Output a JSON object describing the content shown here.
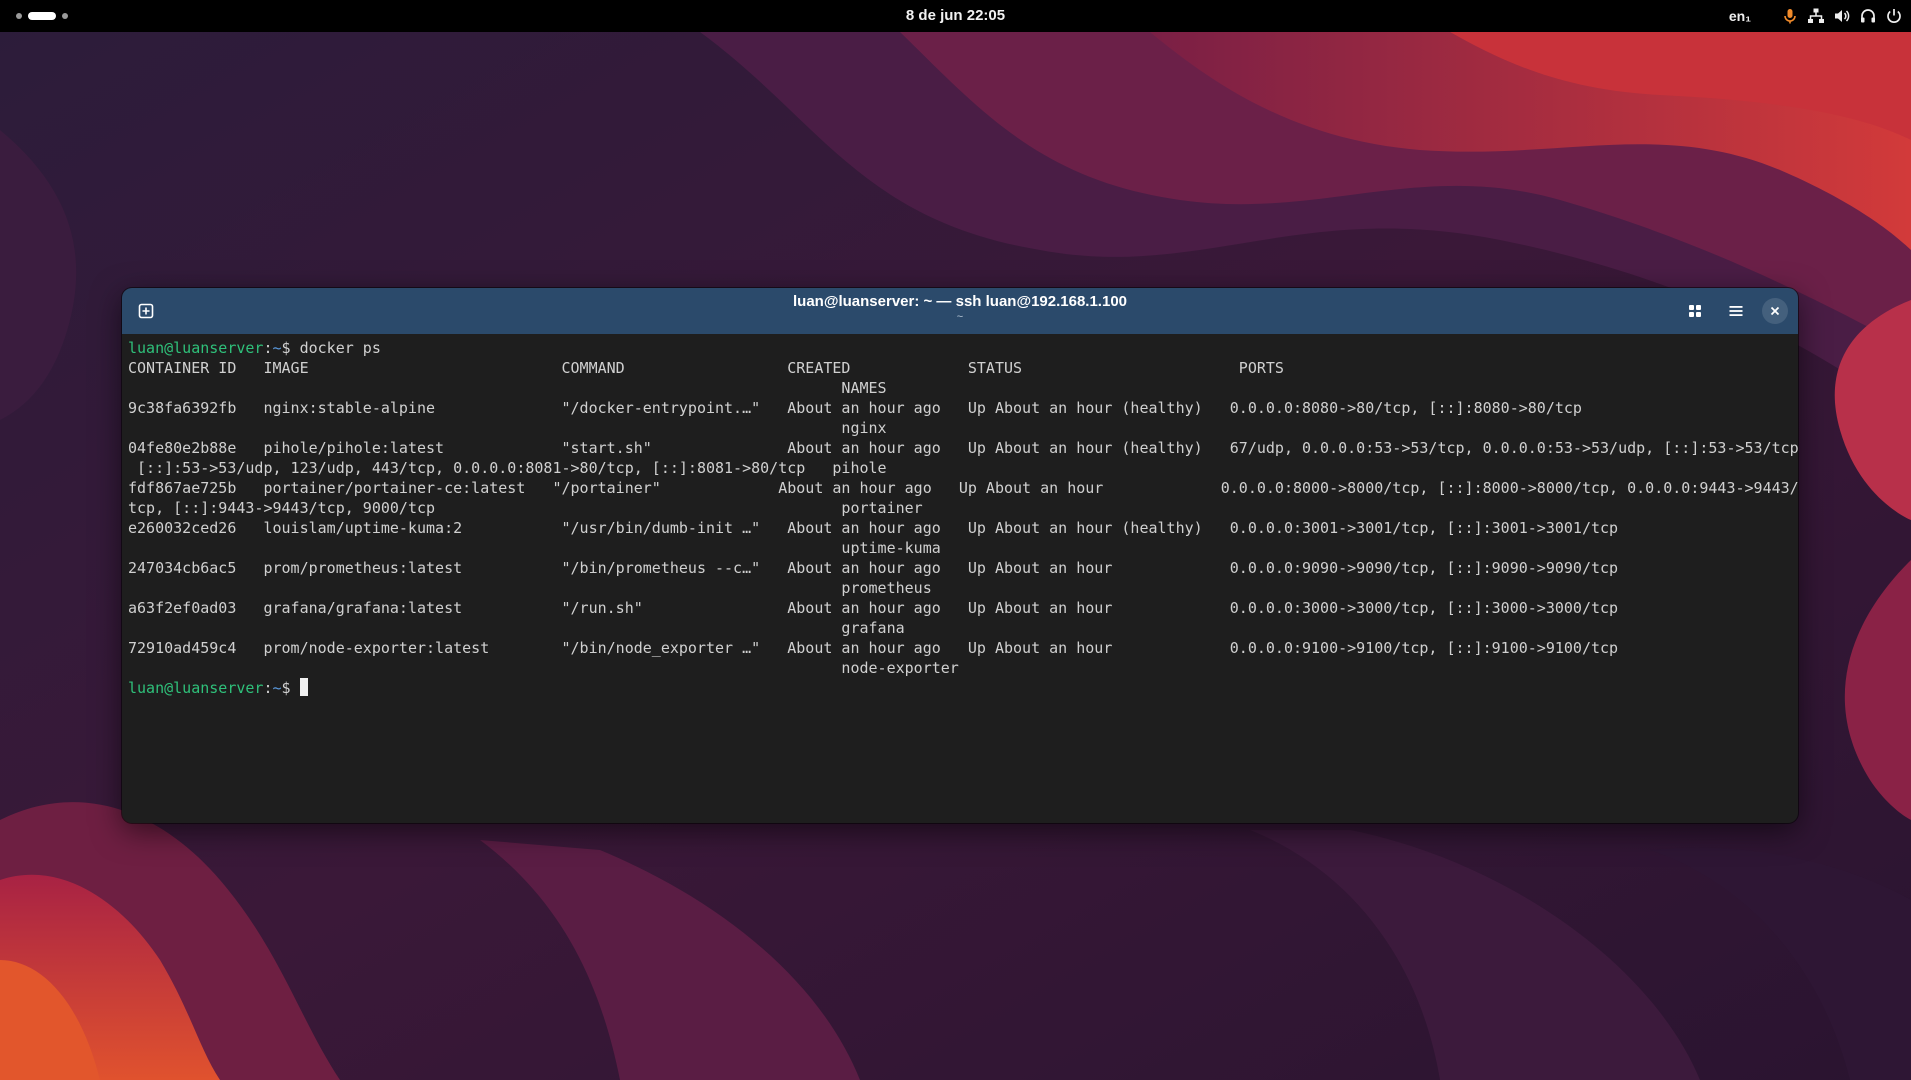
{
  "topbar": {
    "clock": "8 de jun  22:05",
    "keyboard_layout": "en₁",
    "icons": [
      "microphone-icon",
      "network-icon",
      "volume-icon",
      "headset-icon",
      "power-icon"
    ]
  },
  "window": {
    "title": "luan@luanserver: ~ — ssh luan@192.168.1.100",
    "subtitle": "~",
    "accent_color": "#2b4a6b"
  },
  "terminal": {
    "prompt": {
      "user_host": "luan@luanserver",
      "separator": ":",
      "path": "~",
      "symbol": "$ "
    },
    "command": "docker ps",
    "output_lines": [
      "CONTAINER ID   IMAGE                            COMMAND                  CREATED             STATUS                        PORTS",
      "                                                                               NAMES",
      "9c38fa6392fb   nginx:stable-alpine              \"/docker-entrypoint.…\"   About an hour ago   Up About an hour (healthy)   0.0.0.0:8080->80/tcp, [::]:8080->80/tcp",
      "                                                                               nginx",
      "04fe80e2b88e   pihole/pihole:latest             \"start.sh\"               About an hour ago   Up About an hour (healthy)   67/udp, 0.0.0.0:53->53/tcp, 0.0.0.0:53->53/udp, [::]:53->53/tcp,",
      " [::]:53->53/udp, 123/udp, 443/tcp, 0.0.0.0:8081->80/tcp, [::]:8081->80/tcp   pihole",
      "fdf867ae725b   portainer/portainer-ce:latest   \"/portainer\"             About an hour ago   Up About an hour             0.0.0.0:8000->8000/tcp, [::]:8000->8000/tcp, 0.0.0.0:9443->9443/",
      "tcp, [::]:9443->9443/tcp, 9000/tcp                                             portainer",
      "e260032ced26   louislam/uptime-kuma:2           \"/usr/bin/dumb-init …\"   About an hour ago   Up About an hour (healthy)   0.0.0.0:3001->3001/tcp, [::]:3001->3001/tcp",
      "                                                                               uptime-kuma",
      "247034cb6ac5   prom/prometheus:latest           \"/bin/prometheus --c…\"   About an hour ago   Up About an hour             0.0.0.0:9090->9090/tcp, [::]:9090->9090/tcp",
      "                                                                               prometheus",
      "a63f2ef0ad03   grafana/grafana:latest           \"/run.sh\"                About an hour ago   Up About an hour             0.0.0.0:3000->3000/tcp, [::]:3000->3000/tcp",
      "                                                                               grafana",
      "72910ad459c4   prom/node-exporter:latest        \"/bin/node_exporter …\"   About an hour ago   Up About an hour             0.0.0.0:9100->9100/tcp, [::]:9100->9100/tcp",
      "                                                                               node-exporter"
    ]
  }
}
